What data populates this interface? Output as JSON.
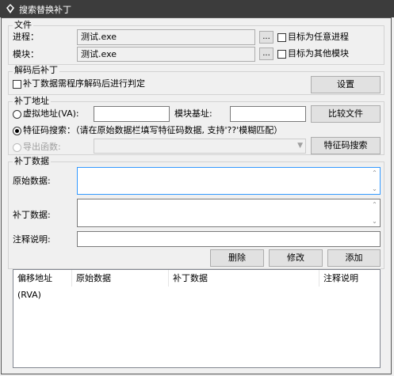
{
  "window": {
    "title": "搜索替换补丁"
  },
  "file_group": {
    "legend": "文件",
    "process_label": "进程：",
    "process_value": "测试.exe",
    "process_browse": "...",
    "target_any_process": "目标为任意进程",
    "module_label": "模块：",
    "module_value": "测试.exe",
    "module_browse": "...",
    "target_other_module": "目标为其他模块"
  },
  "decode_group": {
    "legend": "解码后补丁",
    "checkbox_label": "补丁数据需程序解码后进行判定",
    "settings_button": "设置"
  },
  "address_group": {
    "legend": "补丁地址",
    "virtual_address_label": "虚拟地址(VA):",
    "module_base_label": "模块基址:",
    "compare_files_button": "比较文件",
    "signature_search_label": "特征码搜索：（请在原始数据栏填写特征码数据, 支持'??'模糊匹配）",
    "export_function_label": "导出函数:",
    "signature_search_button": "特征码搜索"
  },
  "patch_group": {
    "legend": "补丁数据",
    "original_data_label": "原始数据:",
    "patch_data_label": "补丁数据:",
    "comment_label": "注释说明:",
    "delete_button": "删除",
    "modify_button": "修改",
    "add_button": "添加"
  },
  "table": {
    "columns": [
      "偏移地址(RVA)",
      "原始数据",
      "补丁数据",
      "注释说明"
    ]
  }
}
